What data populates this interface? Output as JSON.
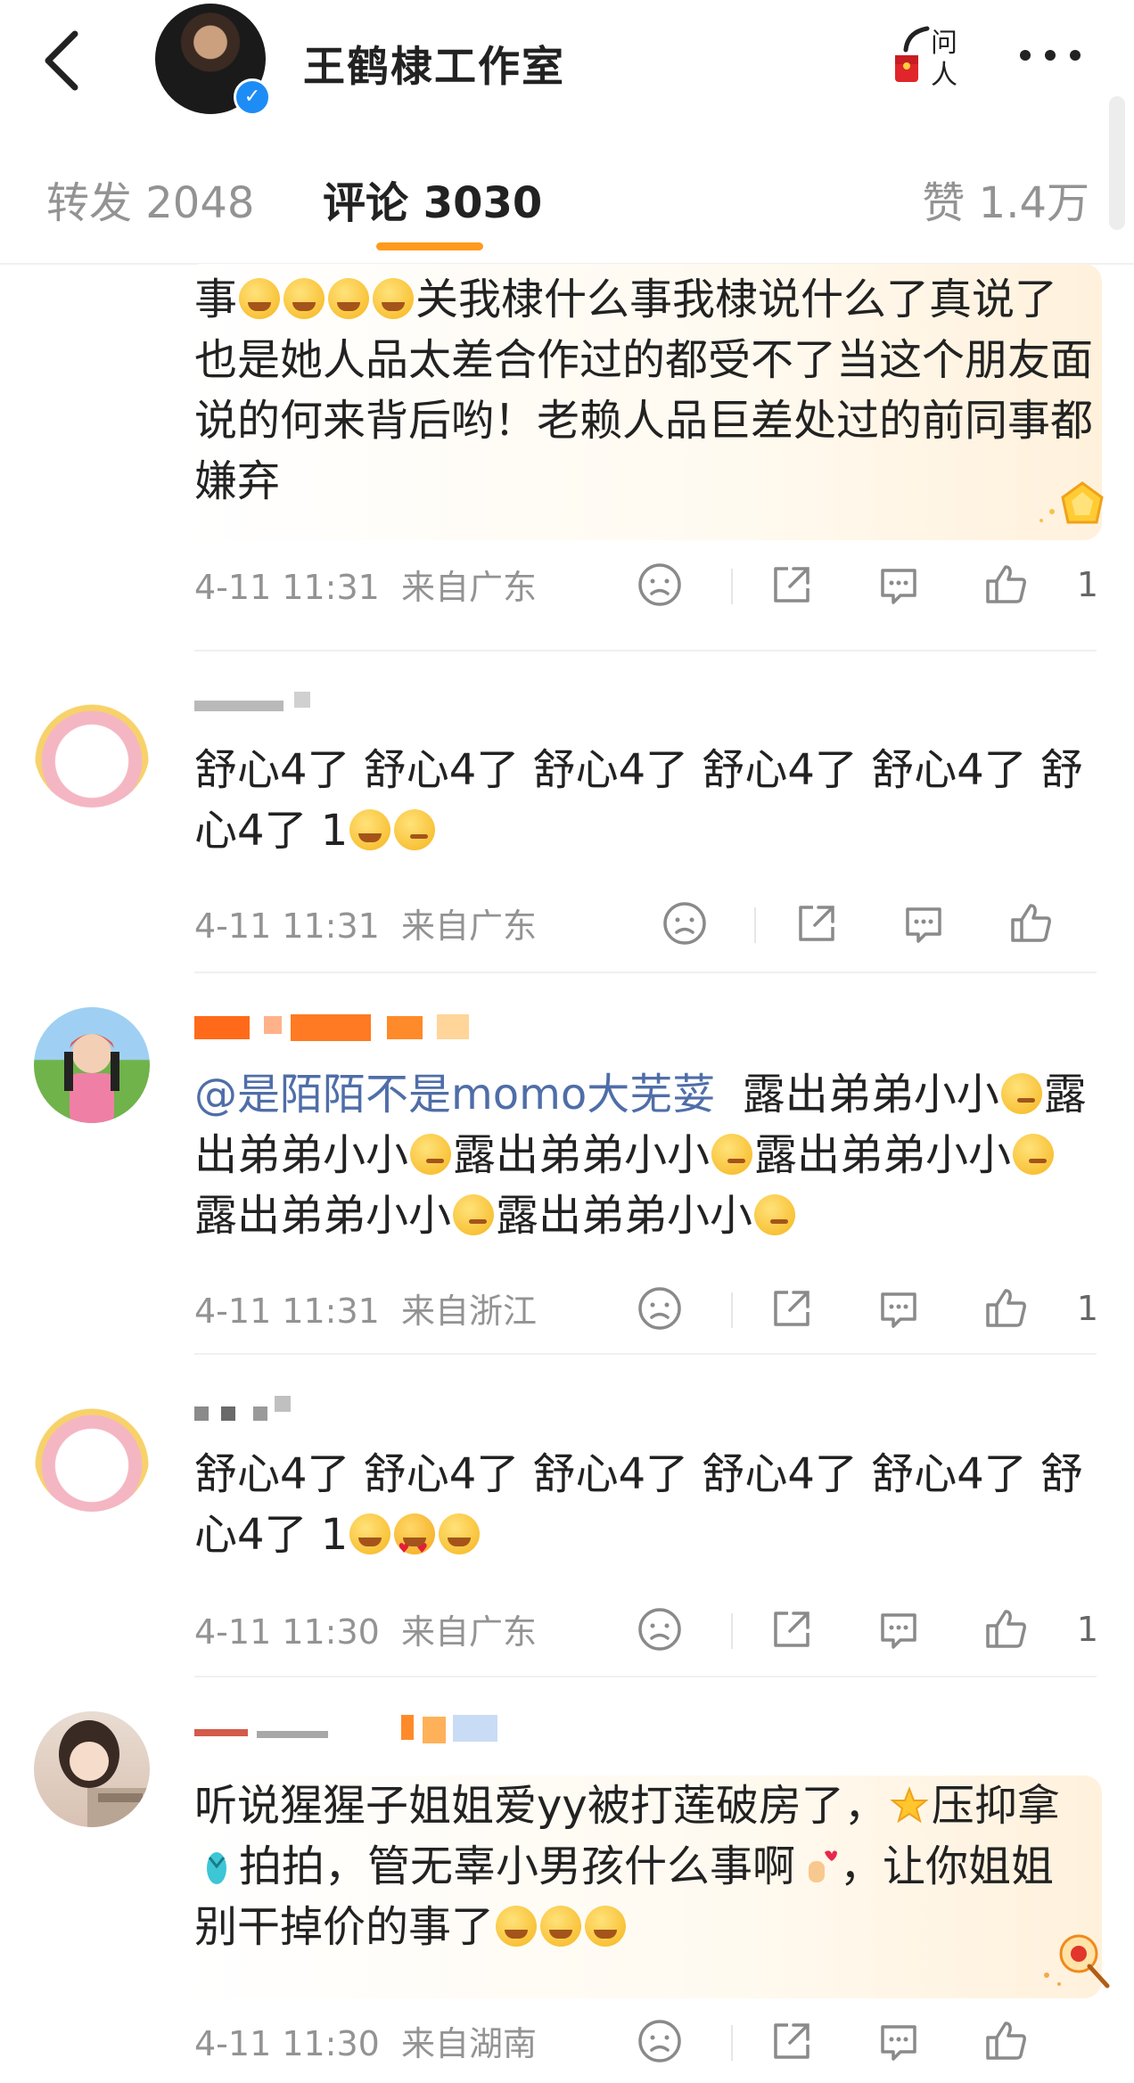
{
  "header": {
    "title": "王鹤棣工作室",
    "ask_label_top": "问",
    "ask_label_bottom": "人"
  },
  "tabs": {
    "repost": "转发 2048",
    "comment": "评论 3030",
    "like": "赞 1.4万"
  },
  "comments": [
    {
      "text_line1": "事",
      "text_line1b": "关我棣什么事我棣说什么了真",
      "text_rest": "说了也是她人品太差合作过的都受不了当这个朋友面说的何来背后哟！老赖人品巨差处过的前同事都嫌弃",
      "time": "4-11 11:31",
      "location": "来自广东",
      "likes": "1"
    },
    {
      "text": "舒心4了 舒心4了 舒心4了 舒心4了 舒心4了 舒心4了 1",
      "time": "4-11 11:31",
      "location": "来自广东",
      "likes": ""
    },
    {
      "mention": "@是陌陌不是momo大芜荽",
      "text_part": "露出弟弟小小",
      "time": "4-11 11:31",
      "location": "来自浙江",
      "likes": "1"
    },
    {
      "text": "舒心4了 舒心4了 舒心4了 舒心4了 舒心4了 舒心4了 1",
      "time": "4-11 11:30",
      "location": "来自广东",
      "likes": "1"
    },
    {
      "text_a": "听说猩猩子姐姐爱yy被打莲破房了，",
      "text_b": "压抑拿",
      "text_c": "拍拍，管无辜小男孩什么事啊",
      "text_d": "，让你姐姐别干掉价的事了",
      "time": "4-11 11:30",
      "location": "来自湖南",
      "likes": ""
    }
  ],
  "colors": {
    "accent": "#ff9a1f",
    "verified": "#1e8cf5",
    "mention": "#4f6ea8",
    "meta": "#939393"
  }
}
